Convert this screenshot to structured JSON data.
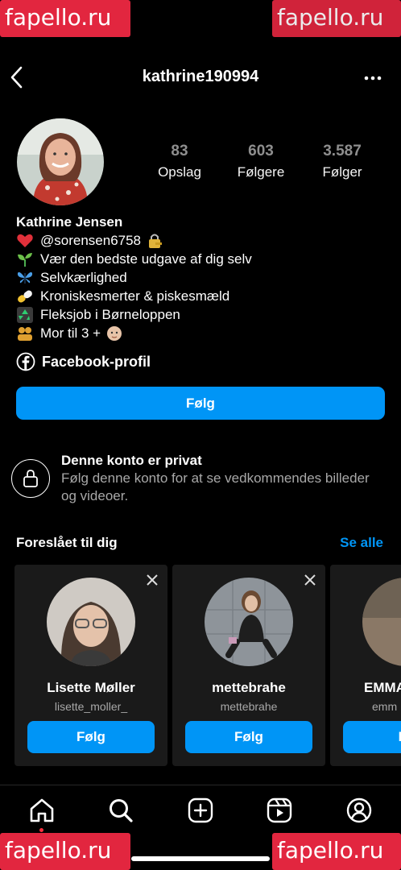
{
  "watermark": "fapello.ru",
  "header": {
    "username": "kathrine190994"
  },
  "stats": [
    {
      "value": "83",
      "label": "Opslag"
    },
    {
      "value": "603",
      "label": "Følgere"
    },
    {
      "value": "3.587",
      "label": "Følger"
    }
  ],
  "bio": {
    "name": "Kathrine Jensen",
    "lines": [
      {
        "icon": "heart-icon",
        "text": "@sorensen6758"
      },
      {
        "icon": "seedling-icon",
        "text": "Vær den bedste udgave af dig selv"
      },
      {
        "icon": "butterfly-icon",
        "text": "Selvkærlighed"
      },
      {
        "icon": "pill-icon",
        "text": "Kroniskesmerter & piskesmæld"
      },
      {
        "icon": "recycle-icon",
        "text": "Fleksjob i Børneloppen"
      },
      {
        "icon": "family-icon",
        "text": "Mor til 3 +"
      }
    ],
    "facebook_label": "Facebook-profil"
  },
  "follow_button": "Følg",
  "private": {
    "title": "Denne konto er privat",
    "description": "Følg denne konto for at se vedkommendes billeder og videoer."
  },
  "suggestions": {
    "heading": "Foreslået til dig",
    "see_all": "Se alle",
    "cards": [
      {
        "name": "Lisette Møller",
        "username": "lisette_moller_",
        "button": "Følg"
      },
      {
        "name": "mettebrahe",
        "username": "mettebrahe",
        "button": "Følg"
      },
      {
        "name": "EMMA",
        "username": "emm",
        "button": "Fø"
      }
    ]
  },
  "colors": {
    "accent": "#0095f6",
    "background": "#000000",
    "card": "#1a1a1a",
    "watermark": "#e2263f"
  }
}
